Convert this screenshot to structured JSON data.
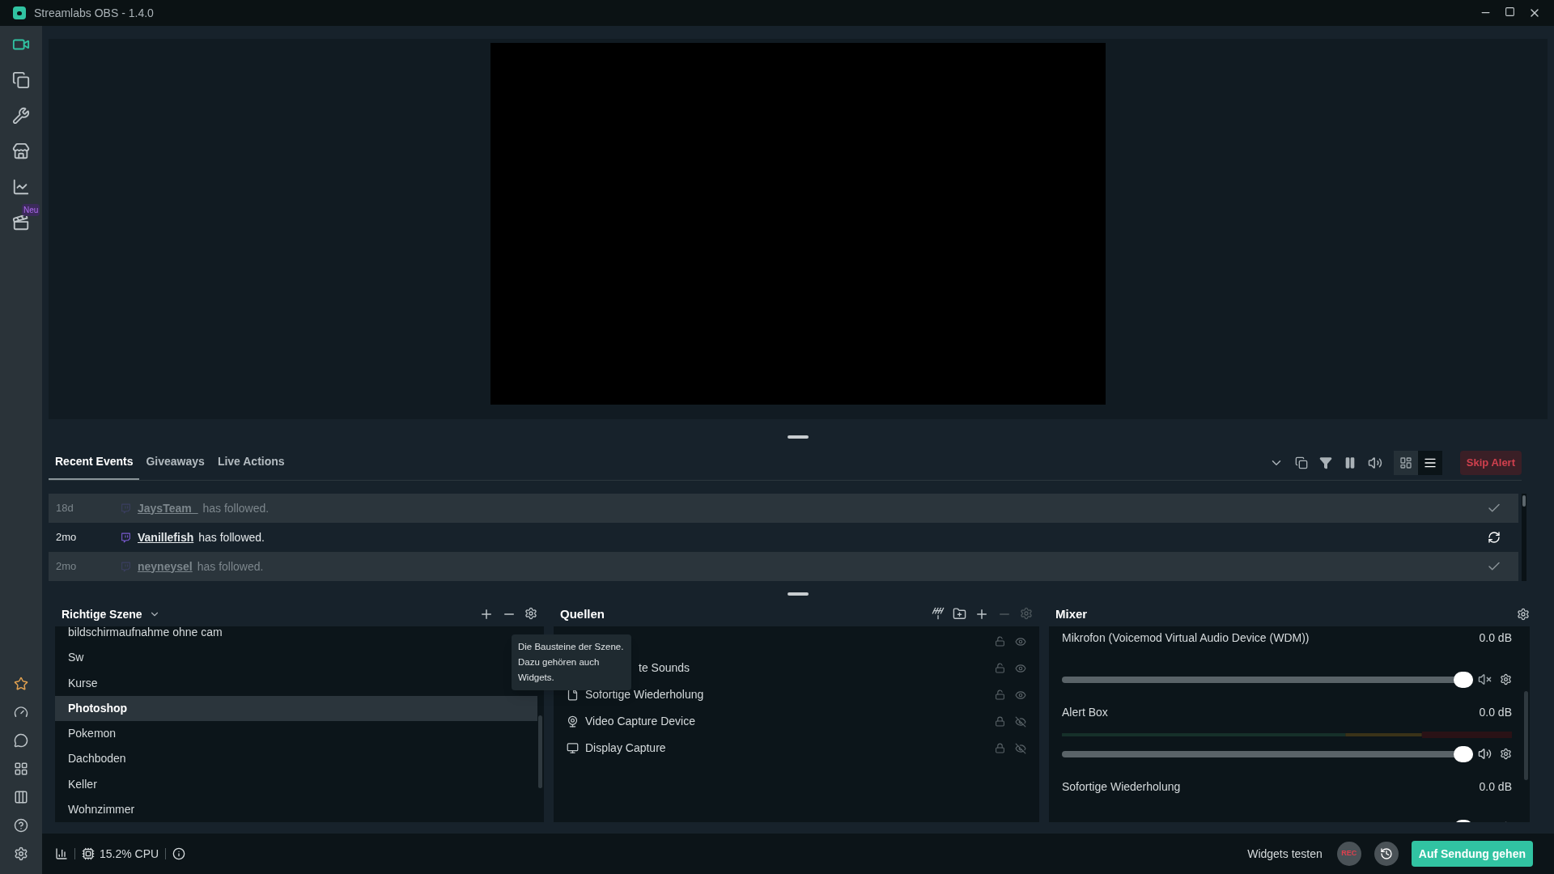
{
  "window": {
    "title": "Streamlabs OBS - 1.4.0"
  },
  "sidebar": {
    "top_items": [
      {
        "kind": "camera",
        "selected": true
      },
      {
        "kind": "copy",
        "selected": false
      },
      {
        "kind": "tools",
        "selected": false
      },
      {
        "kind": "store",
        "selected": false
      },
      {
        "kind": "chart",
        "selected": false
      },
      {
        "kind": "clapper",
        "selected": false,
        "badge": "Neu"
      }
    ],
    "bottom_items": [
      {
        "kind": "star"
      },
      {
        "kind": "gauge"
      },
      {
        "kind": "chat"
      },
      {
        "kind": "grid"
      },
      {
        "kind": "columns"
      },
      {
        "kind": "help"
      },
      {
        "kind": "settings"
      }
    ]
  },
  "events": {
    "tabs": [
      {
        "label": "Recent Events",
        "selected": true
      },
      {
        "label": "Giveaways",
        "selected": false
      },
      {
        "label": "Live Actions",
        "selected": false
      }
    ],
    "view_toggles": [
      {
        "kind": "cards",
        "selected": false
      },
      {
        "kind": "list",
        "selected": true
      }
    ],
    "skip_button": "Skip Alert",
    "rows": [
      {
        "time": "18d",
        "user": "JaysTeam_",
        "action": "has followed.",
        "read": true
      },
      {
        "time": "2mo",
        "user": "Vanillefish",
        "action": "has followed.",
        "read": false
      },
      {
        "time": "2mo",
        "user": "neyneysel",
        "action": "has followed.",
        "read": true
      }
    ]
  },
  "scenes": {
    "title": "Richtige Szene",
    "items": [
      {
        "name": "bildschirmaufnahme ohne cam",
        "selected": false
      },
      {
        "name": "Sw",
        "selected": false
      },
      {
        "name": "Kurse",
        "selected": false
      },
      {
        "name": "Photoshop",
        "selected": true
      },
      {
        "name": "Pokemon",
        "selected": false
      },
      {
        "name": "Dachboden",
        "selected": false
      },
      {
        "name": "Keller",
        "selected": false
      },
      {
        "name": "Wohnzimmer",
        "selected": false
      }
    ]
  },
  "sources": {
    "title": "Quellen",
    "tooltip": "Die Bausteine der Szene. Dazu gehören auch Widgets.",
    "items": [
      {
        "kind": "hidden",
        "locked": false,
        "visible": true
      },
      {
        "kind": "hidden",
        "name": "te Sounds",
        "locked": false,
        "visible": true
      },
      {
        "kind": "file",
        "name": "Sofortige Wiederholung",
        "locked": false,
        "visible": true
      },
      {
        "kind": "webcam",
        "name": "Video Capture Device",
        "locked": true,
        "visible": false
      },
      {
        "kind": "monitor",
        "name": "Display Capture",
        "locked": true,
        "visible": false
      }
    ]
  },
  "mixer": {
    "title": "Mixer",
    "channels": [
      {
        "name": "Mikrofon (Voicemod Virtual Audio Device (WDM))",
        "reading": "0.0 dB",
        "level": 1,
        "muted": true,
        "meter": false
      },
      {
        "name": "Alert Box",
        "reading": "0.0 dB",
        "level": 1,
        "muted": false,
        "meter": true
      },
      {
        "name": "Sofortige Wiederholung",
        "reading": "0.0 dB",
        "level": 1,
        "meter": false
      }
    ]
  },
  "footer": {
    "cpu": "15.2% CPU",
    "test_label": "Widgets testen",
    "rec": "REC",
    "go_live": "Auf Sendung gehen"
  }
}
